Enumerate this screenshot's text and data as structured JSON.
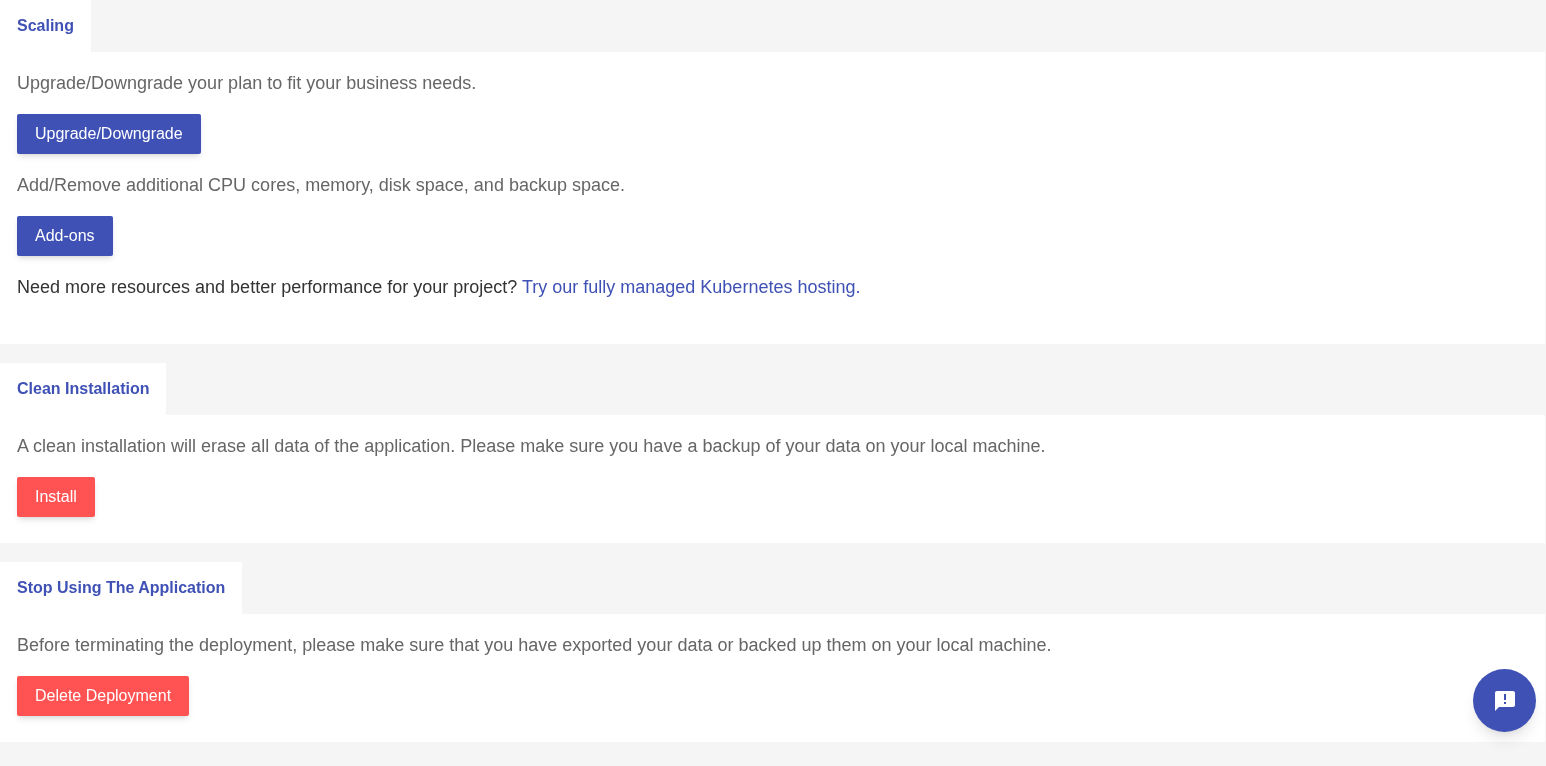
{
  "sections": [
    {
      "tab": "Scaling",
      "blocks": [
        {
          "kind": "text",
          "text": "Upgrade/Downgrade your plan to fit your business needs."
        },
        {
          "kind": "button",
          "label": "Upgrade/Downgrade"
        },
        {
          "kind": "text",
          "text": "Add/Remove additional CPU cores, memory, disk space, and backup space."
        },
        {
          "kind": "button",
          "label": "Add-ons"
        },
        {
          "kind": "text",
          "text": "Need more resources and better performance for your project?",
          "link": "Try our fully managed Kubernetes hosting."
        }
      ]
    },
    {
      "tab": "Clean Installation",
      "blocks": [
        {
          "kind": "text",
          "text": "A clean installation will erase all data of the application. Please make sure you have a backup of your data on your local machine."
        },
        {
          "kind": "danger",
          "label": "Install"
        }
      ]
    },
    {
      "tab": "Stop Using The Application",
      "blocks": [
        {
          "kind": "text",
          "text": "Before terminating the deployment, please make sure that you have exported your data or backed up them on your local machine."
        },
        {
          "kind": "danger",
          "label": "Delete Deployment"
        }
      ]
    }
  ]
}
